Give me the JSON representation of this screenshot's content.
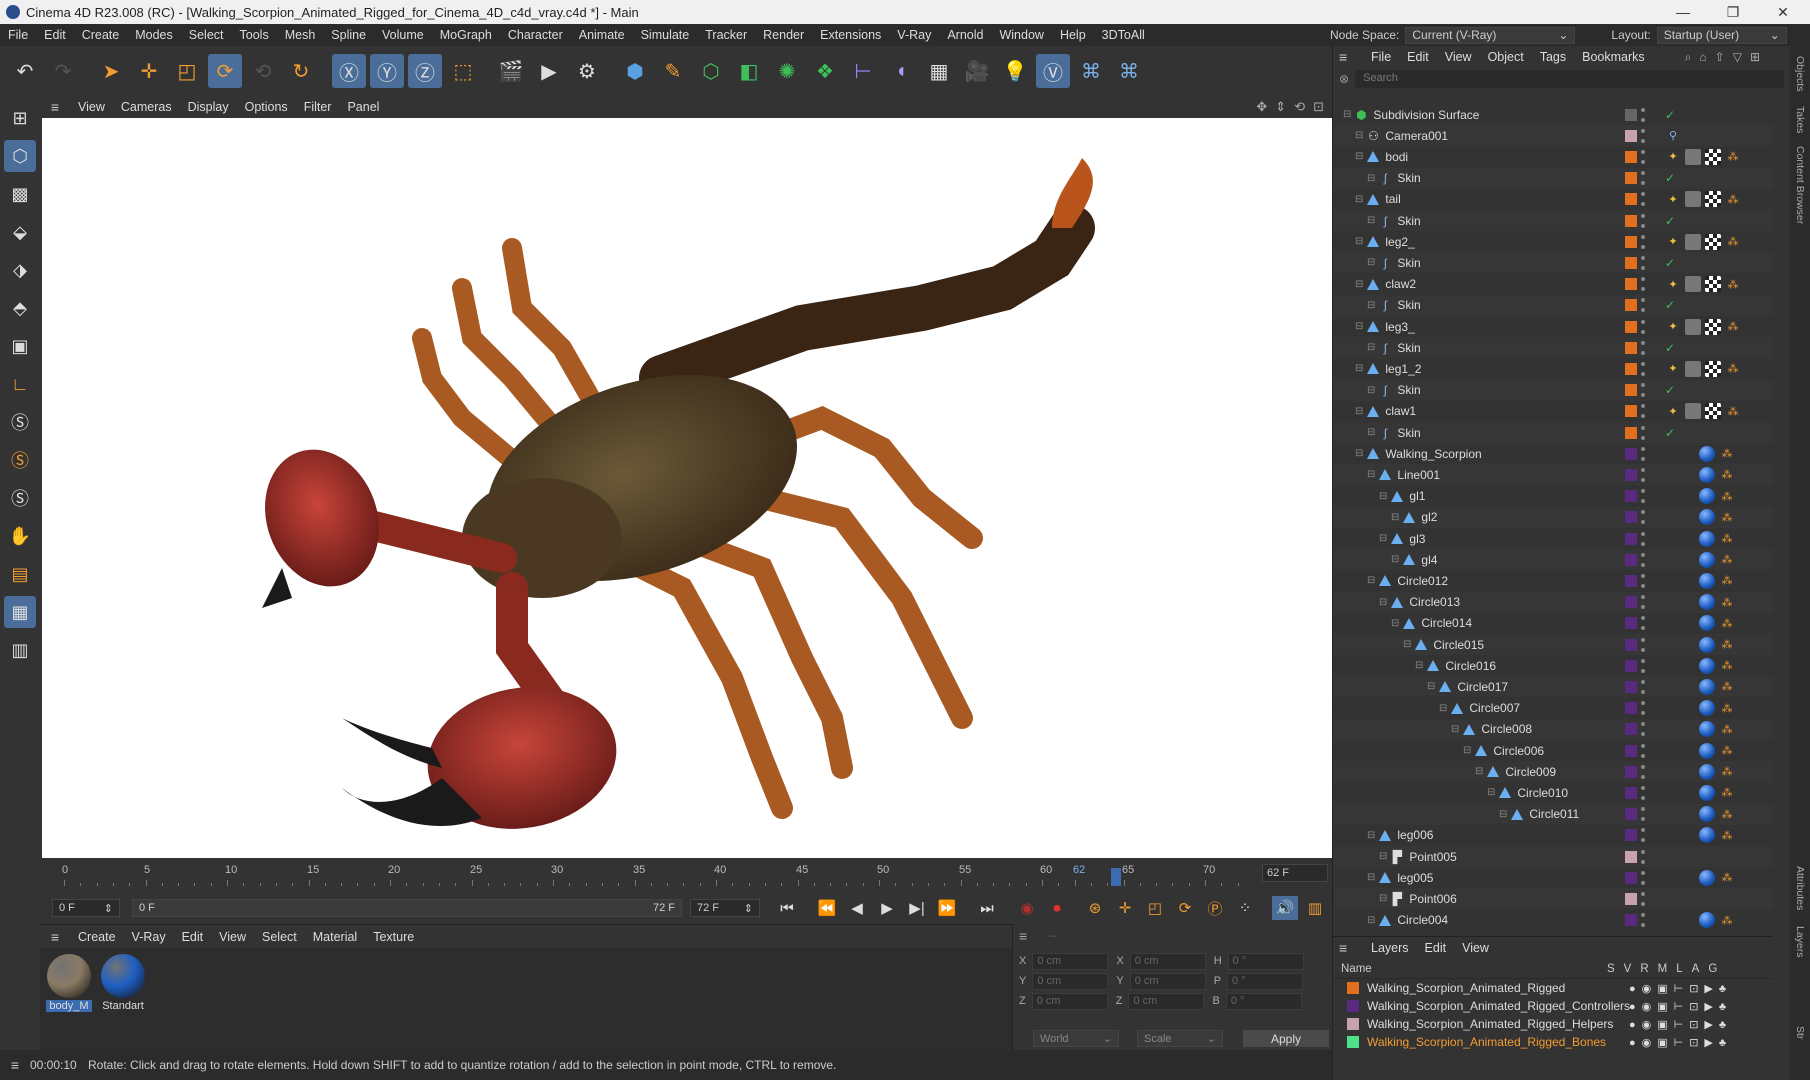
{
  "window": {
    "title": "Cinema 4D R23.008 (RC) - [Walking_Scorpion_Animated_Rigged_for_Cinema_4D_c4d_vray.c4d *] - Main",
    "minimize": "—",
    "maximize": "❐",
    "close": "✕"
  },
  "menubar": [
    "File",
    "Edit",
    "Create",
    "Modes",
    "Select",
    "Tools",
    "Mesh",
    "Spline",
    "Volume",
    "MoGraph",
    "Character",
    "Animate",
    "Simulate",
    "Tracker",
    "Render",
    "Extensions",
    "V-Ray",
    "Arnold",
    "Window",
    "Help",
    "3DToAll"
  ],
  "nodespace": {
    "label": "Node Space:",
    "value": "Current (V-Ray)"
  },
  "layout": {
    "label": "Layout:",
    "value": "Startup (User)"
  },
  "toolbar_icons": [
    "undo-icon",
    "redo-icon",
    "select-icon",
    "move-icon",
    "scale-icon",
    "rotate-icon",
    "recent-tools-icon",
    "rotate-tool-icon",
    "x-axis-icon",
    "y-axis-icon",
    "z-axis-icon",
    "coordinate-system-icon",
    "render-region-icon",
    "render-view-icon",
    "render-settings-icon",
    "cube-icon",
    "pen-icon",
    "subdivision-icon",
    "extrude-icon",
    "mograph-cloner-icon",
    "mograph-effector-icon",
    "deformer-icon",
    "field-icon",
    "floor-icon",
    "camera-icon",
    "light-icon",
    "vray-icon",
    "python-icon",
    "python-icon-2"
  ],
  "viewport_menu": [
    "View",
    "Cameras",
    "Display",
    "Options",
    "Filter",
    "Panel"
  ],
  "timeline": {
    "ticks": [
      "0",
      "5",
      "10",
      "15",
      "20",
      "25",
      "30",
      "35",
      "40",
      "45",
      "50",
      "55",
      "60",
      "62",
      "65",
      "70"
    ],
    "current_frame": "62",
    "end_field": "62 F"
  },
  "transport": {
    "start_field": "0 F",
    "range_start": "0 F",
    "range_end": "72 F",
    "end_field": "72 F"
  },
  "material_menu": [
    "Create",
    "V-Ray",
    "Edit",
    "View",
    "Select",
    "Material",
    "Texture"
  ],
  "materials": [
    {
      "name": "body_M",
      "color": "#8a7a64"
    },
    {
      "name": "Standart",
      "color": "#1f5fc4"
    }
  ],
  "coords": {
    "rows": [
      {
        "a": "X",
        "av": "0 cm",
        "b": "X",
        "bv": "0 cm",
        "c": "H",
        "cv": "0 °"
      },
      {
        "a": "Y",
        "av": "0 cm",
        "b": "Y",
        "bv": "0 cm",
        "c": "P",
        "cv": "0 °"
      },
      {
        "a": "Z",
        "av": "0 cm",
        "b": "Z",
        "bv": "0 cm",
        "c": "B",
        "cv": "0 °"
      }
    ],
    "top_dashes": "--",
    "mode": "World",
    "scale": "Scale",
    "apply": "Apply"
  },
  "status": {
    "time": "00:00:10",
    "message": "Rotate: Click and drag to rotate elements. Hold down SHIFT to add to quantize rotation / add to the selection in point mode, CTRL to remove."
  },
  "objects_menu": [
    "File",
    "Edit",
    "View",
    "Object",
    "Tags",
    "Bookmarks"
  ],
  "search_placeholder": "Search",
  "objects": [
    {
      "name": "Subdivision Surface",
      "indent": 0,
      "icon": "subdivision",
      "color": "#666",
      "tags": "check"
    },
    {
      "name": "Camera001",
      "indent": 1,
      "icon": "camera",
      "color": "#c9a0b0",
      "tags": "camtag"
    },
    {
      "name": "bodi",
      "indent": 1,
      "icon": "tri",
      "color": "#e07020",
      "tags": "mat"
    },
    {
      "name": "Skin",
      "indent": 2,
      "icon": "skin",
      "color": "#e07020",
      "tags": "check"
    },
    {
      "name": "tail",
      "indent": 1,
      "icon": "tri",
      "color": "#e07020",
      "tags": "mat"
    },
    {
      "name": "Skin",
      "indent": 2,
      "icon": "skin",
      "color": "#e07020",
      "tags": "check"
    },
    {
      "name": "leg2_",
      "indent": 1,
      "icon": "tri",
      "color": "#e07020",
      "tags": "mat"
    },
    {
      "name": "Skin",
      "indent": 2,
      "icon": "skin",
      "color": "#e07020",
      "tags": "check"
    },
    {
      "name": "claw2",
      "indent": 1,
      "icon": "tri",
      "color": "#e07020",
      "tags": "mat"
    },
    {
      "name": "Skin",
      "indent": 2,
      "icon": "skin",
      "color": "#e07020",
      "tags": "check"
    },
    {
      "name": "leg3_",
      "indent": 1,
      "icon": "tri",
      "color": "#e07020",
      "tags": "mat"
    },
    {
      "name": "Skin",
      "indent": 2,
      "icon": "skin",
      "color": "#e07020",
      "tags": "check"
    },
    {
      "name": "leg1_2",
      "indent": 1,
      "icon": "tri",
      "color": "#e07020",
      "tags": "mat"
    },
    {
      "name": "Skin",
      "indent": 2,
      "icon": "skin",
      "color": "#e07020",
      "tags": "check"
    },
    {
      "name": "claw1",
      "indent": 1,
      "icon": "tri",
      "color": "#e07020",
      "tags": "mat"
    },
    {
      "name": "Skin",
      "indent": 2,
      "icon": "skin",
      "color": "#e07020",
      "tags": "check"
    },
    {
      "name": "Walking_Scorpion",
      "indent": 1,
      "icon": "tri",
      "color": "#5a2a80",
      "tags": "sphere"
    },
    {
      "name": "Line001",
      "indent": 2,
      "icon": "tri",
      "color": "#5a2a80",
      "tags": "sphere"
    },
    {
      "name": "gl1",
      "indent": 3,
      "icon": "tri",
      "color": "#5a2a80",
      "tags": "sphere"
    },
    {
      "name": "gl2",
      "indent": 4,
      "icon": "tri",
      "color": "#5a2a80",
      "tags": "sphere"
    },
    {
      "name": "gl3",
      "indent": 3,
      "icon": "tri",
      "color": "#5a2a80",
      "tags": "sphere"
    },
    {
      "name": "gl4",
      "indent": 4,
      "icon": "tri",
      "color": "#5a2a80",
      "tags": "sphere"
    },
    {
      "name": "Circle012",
      "indent": 2,
      "icon": "tri",
      "color": "#5a2a80",
      "tags": "sphere"
    },
    {
      "name": "Circle013",
      "indent": 3,
      "icon": "tri",
      "color": "#5a2a80",
      "tags": "sphere"
    },
    {
      "name": "Circle014",
      "indent": 4,
      "icon": "tri",
      "color": "#5a2a80",
      "tags": "sphere"
    },
    {
      "name": "Circle015",
      "indent": 5,
      "icon": "tri",
      "color": "#5a2a80",
      "tags": "sphere"
    },
    {
      "name": "Circle016",
      "indent": 6,
      "icon": "tri",
      "color": "#5a2a80",
      "tags": "sphere"
    },
    {
      "name": "Circle017",
      "indent": 7,
      "icon": "tri",
      "color": "#5a2a80",
      "tags": "sphere"
    },
    {
      "name": "Circle007",
      "indent": 8,
      "icon": "tri",
      "color": "#5a2a80",
      "tags": "sphere"
    },
    {
      "name": "Circle008",
      "indent": 9,
      "icon": "tri",
      "color": "#5a2a80",
      "tags": "sphere"
    },
    {
      "name": "Circle006",
      "indent": 10,
      "icon": "tri",
      "color": "#5a2a80",
      "tags": "sphere"
    },
    {
      "name": "Circle009",
      "indent": 11,
      "icon": "tri",
      "color": "#5a2a80",
      "tags": "sphere"
    },
    {
      "name": "Circle010",
      "indent": 12,
      "icon": "tri",
      "color": "#5a2a80",
      "tags": "sphere"
    },
    {
      "name": "Circle011",
      "indent": 13,
      "icon": "tri",
      "color": "#5a2a80",
      "tags": "sphere"
    },
    {
      "name": "leg006",
      "indent": 2,
      "icon": "tri",
      "color": "#5a2a80",
      "tags": "sphere"
    },
    {
      "name": "Point005",
      "indent": 3,
      "icon": "point",
      "color": "#c9a0b0",
      "tags": "none"
    },
    {
      "name": "leg005",
      "indent": 2,
      "icon": "tri",
      "color": "#5a2a80",
      "tags": "sphere"
    },
    {
      "name": "Point006",
      "indent": 3,
      "icon": "point",
      "color": "#c9a0b0",
      "tags": "none"
    },
    {
      "name": "Circle004",
      "indent": 2,
      "icon": "tri",
      "color": "#5a2a80",
      "tags": "sphere"
    }
  ],
  "layers_menu": [
    "Layers",
    "Edit",
    "View"
  ],
  "layers_header": {
    "name": "Name",
    "cols": [
      "S",
      "V",
      "R",
      "M",
      "L",
      "A",
      "G"
    ]
  },
  "layers": [
    {
      "name": "Walking_Scorpion_Animated_Rigged",
      "color": "#e07020",
      "text_color": "#dddddd"
    },
    {
      "name": "Walking_Scorpion_Animated_Rigged_Controllers",
      "color": "#5a2a80",
      "text_color": "#dddddd"
    },
    {
      "name": "Walking_Scorpion_Animated_Rigged_Helpers",
      "color": "#c9a0b0",
      "text_color": "#dddddd"
    },
    {
      "name": "Walking_Scorpion_Animated_Rigged_Bones",
      "color": "#4fe08a",
      "text_color": "#f39c32"
    }
  ],
  "side_tabs": [
    "Objects",
    "Takes",
    "Content Browser",
    "Attributes",
    "Layers",
    "Str"
  ]
}
